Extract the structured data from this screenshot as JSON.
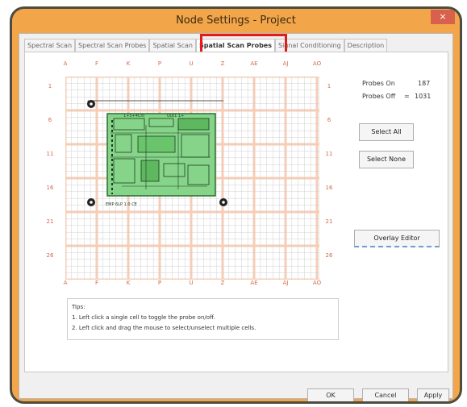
{
  "window": {
    "title": "Node Settings - Project",
    "close_label": "×"
  },
  "tabs": [
    {
      "label": "Spectral Scan"
    },
    {
      "label": "Spectral Scan Probes"
    },
    {
      "label": "Spatial Scan"
    },
    {
      "label": "Spatial Scan Probes"
    },
    {
      "label": "Signal Conditioning"
    },
    {
      "label": "Description"
    }
  ],
  "grid": {
    "col_labels": [
      "A",
      "F",
      "K",
      "P",
      "U",
      "Z",
      "AE",
      "AJ",
      "AO"
    ],
    "row_labels": [
      "1",
      "6",
      "11",
      "16",
      "21",
      "26"
    ],
    "board": {
      "label_top_a": "1+5+4Cm",
      "label_top_b": "Out1 1+",
      "label_bottom": "EMP 6LP 1.0 CE"
    }
  },
  "probes": {
    "on_label": "Probes On",
    "on_value": "187",
    "off_label": "Probes Off",
    "off_equals": "=",
    "off_value": "1031"
  },
  "buttons": {
    "select_all": "Select All",
    "select_none": "Select None",
    "overlay_editor": "Overlay Editor",
    "ok": "OK",
    "cancel": "Cancel",
    "apply": "Apply"
  },
  "tips": {
    "heading": "Tips:",
    "line1": "1. Left click a single cell to toggle the probe on/off.",
    "line2": "2. Left click and drag the mouse to select/unselect multiple cells."
  }
}
